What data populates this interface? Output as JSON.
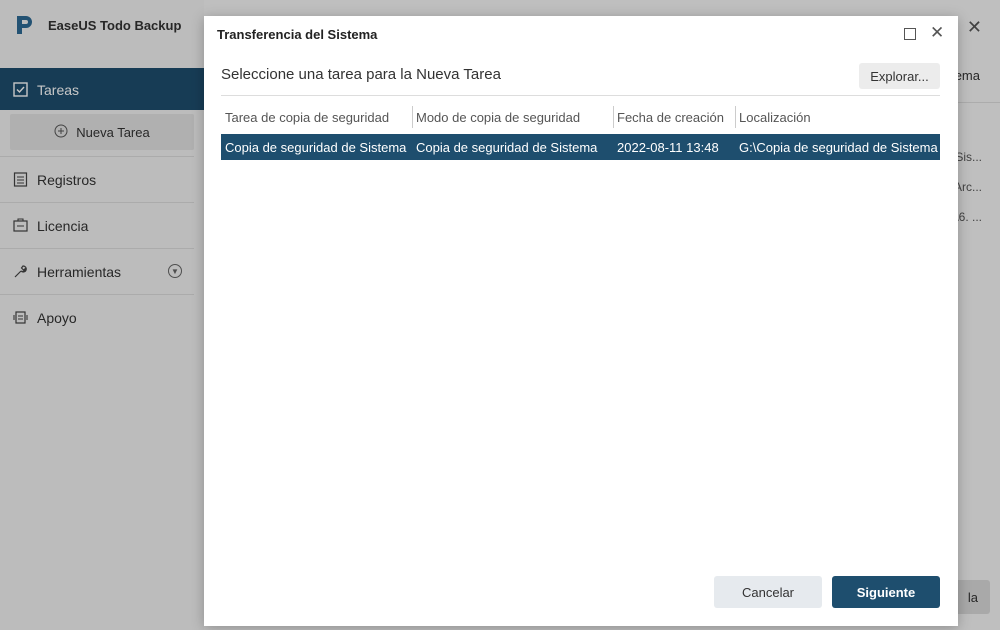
{
  "app": {
    "name": "EaseUS Todo Backup"
  },
  "sidebar": {
    "items": [
      {
        "label": "Tareas",
        "icon": "tasks-icon"
      },
      {
        "label": "Registros",
        "icon": "logs-icon"
      },
      {
        "label": "Licencia",
        "icon": "license-icon"
      },
      {
        "label": "Herramientas",
        "icon": "tools-icon"
      },
      {
        "label": "Apoyo",
        "icon": "support-icon"
      }
    ],
    "new_task_label": "Nueva Tarea"
  },
  "main": {
    "close_glyph": "✕",
    "header_partial": "ema",
    "peek_texts": [
      "Sis...",
      "Arc...",
      "\\6. ..."
    ],
    "button_partial": "la"
  },
  "dialog": {
    "title": "Transferencia del Sistema",
    "subtitle": "Seleccione una tarea para la Nueva Tarea",
    "browse_label": "Explorar...",
    "columns": [
      "Tarea de copia de seguridad",
      "Modo de copia de seguridad",
      "Fecha de creación",
      "Localización"
    ],
    "rows": [
      [
        "Copia de seguridad de Sistema",
        "Copia de seguridad de Sistema",
        "2022-08-11 13:48",
        "G:\\Copia de seguridad de Sistema"
      ]
    ],
    "cancel_label": "Cancelar",
    "next_label": "Siguiente",
    "close_glyph": "✕"
  },
  "colors": {
    "accent": "#1e4e6e",
    "cancel_bg": "#e6eaee"
  }
}
